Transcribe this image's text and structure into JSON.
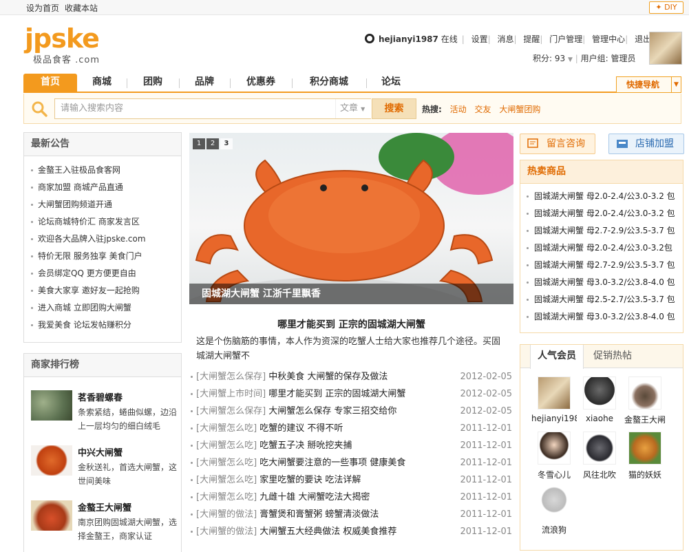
{
  "topbar": {
    "sethome": "设为首页",
    "bookmark": "收藏本站",
    "diy": "DIY"
  },
  "logo": {
    "brand": "jpske",
    "subtitle": "极品食客 .com"
  },
  "user": {
    "name": "hejianyi1987",
    "status": "在线",
    "links": [
      "设置",
      "消息",
      "提醒",
      "门户管理",
      "管理中心",
      "退出"
    ],
    "points_label": "积分: 93",
    "group_label": "用户组: 管理员"
  },
  "nav": {
    "items": [
      "首页",
      "商城",
      "团购",
      "品牌",
      "优惠券",
      "积分商城",
      "论坛"
    ],
    "active": 0,
    "quick_nav": "快捷导航"
  },
  "search": {
    "placeholder": "请输入搜索内容",
    "type": "文章",
    "button": "搜索",
    "hot_label": "热搜:",
    "hot": [
      "活动",
      "交友",
      "大闸蟹团购"
    ]
  },
  "notices": {
    "title": "最新公告",
    "items": [
      "金螯王入驻极品食客网",
      "商家加盟 商城产品直通",
      "大闸蟹团购频道开通",
      "论坛商城特价汇 商家发言区",
      "欢迎各大品牌入驻jpske.com",
      "特价无限 服务独享 美食门户",
      "会员绑定QQ 更方便更自由",
      "美食大家享 邀好友一起抢购",
      "进入商城 立即团购大闸蟹",
      "我爱美食 论坛发帖赚积分"
    ]
  },
  "ranking": {
    "title": "商家排行榜",
    "items": [
      {
        "name": "茗香碧螺春",
        "desc": "条索紧结，蜷曲似螺，边沿上一层均匀的细白绒毛"
      },
      {
        "name": "中兴大闸蟹",
        "desc": "金秋送礼，首选大闸蟹，这世间美味"
      },
      {
        "name": "金螯王大闸蟹",
        "desc": "南京团购固城湖大闸蟹，选择金螯王，商家认证"
      }
    ]
  },
  "slider": {
    "pages": [
      "1",
      "2",
      "3"
    ],
    "active": 2,
    "caption": "固城湖大闸蟹 江浙千里飘香"
  },
  "article": {
    "title": "哪里才能买到 正宗的固城湖大闸蟹",
    "desc": "这是个伤脑筋的事情，本人作为资深的吃蟹人士给大家也推荐几个途径。买固城湖大闸蟹不",
    "list": [
      {
        "cat": "[大闸蟹怎么保存]",
        "title": "中秋美食 大闸蟹的保存及做法",
        "date": "2012-02-05"
      },
      {
        "cat": "[大闸蟹上市时间]",
        "title": "哪里才能买到 正宗的固城湖大闸蟹",
        "date": "2012-02-05"
      },
      {
        "cat": "[大闸蟹怎么保存]",
        "title": "大闸蟹怎么保存 专家三招交给你",
        "date": "2012-02-05"
      },
      {
        "cat": "[大闸蟹怎么吃]",
        "title": "吃蟹的建议 不得不听",
        "date": "2011-12-01"
      },
      {
        "cat": "[大闸蟹怎么吃]",
        "title": "吃蟹五子决 掰吮挖夹捕",
        "date": "2011-12-01"
      },
      {
        "cat": "[大闸蟹怎么吃]",
        "title": "吃大闸蟹要注意的一些事项 健康美食",
        "date": "2011-12-01"
      },
      {
        "cat": "[大闸蟹怎么吃]",
        "title": "家里吃蟹的要诀 吃法详解",
        "date": "2011-12-01"
      },
      {
        "cat": "[大闸蟹怎么吃]",
        "title": "九雌十雄 大闸蟹吃法大揭密",
        "date": "2011-12-01"
      },
      {
        "cat": "[大闸蟹的做法]",
        "title": "膏蟹煲和膏蟹粥 螃蟹清淡做法",
        "date": "2011-12-01"
      },
      {
        "cat": "[大闸蟹的做法]",
        "title": "大闸蟹五大经典做法 权威美食推荐",
        "date": "2011-12-01"
      }
    ]
  },
  "right": {
    "consult_btn": "留言咨询",
    "join_btn": "店铺加盟",
    "hot_title": "热卖商品",
    "hot_items": [
      "固城湖大闸蟹 母2.0-2.4/公3.0-3.2 包",
      "固城湖大闸蟹 母2.0-2.4/公3.0-3.2 包",
      "固城湖大闸蟹 母2.7-2.9/公3.5-3.7 包",
      "固城湖大闸蟹 母2.0-2.4/公3.0-3.2包",
      "固城湖大闸蟹 母2.7-2.9/公3.5-3.7 包",
      "固城湖大闸蟹 母3.0-3.2/公3.8-4.0 包",
      "固城湖大闸蟹 母2.5-2.7/公3.5-3.7 包",
      "固城湖大闸蟹 母3.0-3.2/公3.8-4.0 包"
    ],
    "tabs": [
      "人气会员",
      "促销热帖"
    ],
    "members": [
      "hejianyi198",
      "xiaohe",
      "金螯王大闸",
      "冬雪心儿",
      "风往北吹",
      "猫的妖妖",
      "流浪狗"
    ]
  },
  "colors": {
    "accent": "#f39a1e",
    "link": "#e06a00"
  }
}
